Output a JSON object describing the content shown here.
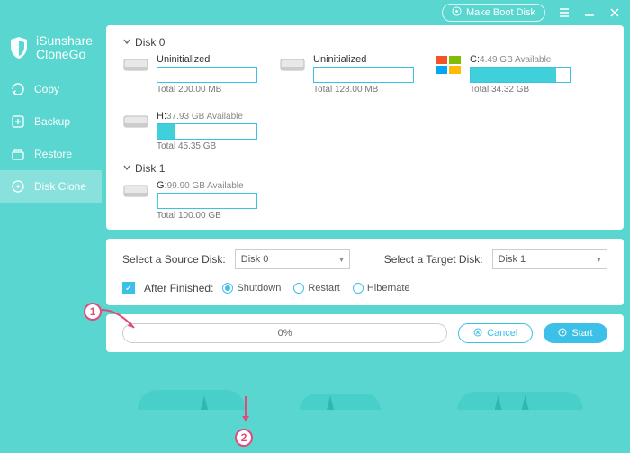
{
  "app": {
    "brand1": "iSunshare",
    "brand2": "CloneGo"
  },
  "titlebar": {
    "make_boot": "Make Boot Disk"
  },
  "sidebar": {
    "items": [
      {
        "label": "Copy"
      },
      {
        "label": "Backup"
      },
      {
        "label": "Restore"
      },
      {
        "label": "Disk Clone"
      }
    ]
  },
  "disks": {
    "d0": {
      "title": "Disk 0",
      "parts": [
        {
          "name": "Uninitialized",
          "avail": "",
          "total": "Total 200.00 MB",
          "fill": 0
        },
        {
          "name": "Uninitialized",
          "avail": "",
          "total": "Total 128.00 MB",
          "fill": 0
        },
        {
          "name": "C:",
          "avail": "4.49 GB Available",
          "total": "Total 34.32 GB",
          "fill": 86,
          "os": true
        },
        {
          "name": "H:",
          "avail": "37.93 GB Available",
          "total": "Total 45.35 GB",
          "fill": 17
        }
      ]
    },
    "d1": {
      "title": "Disk 1",
      "parts": [
        {
          "name": "G:",
          "avail": "99.90 GB Available",
          "total": "Total 100.00 GB",
          "fill": 1
        }
      ]
    }
  },
  "controls": {
    "source_label": "Select a Source Disk:",
    "source_value": "Disk 0",
    "target_label": "Select a Target Disk:",
    "target_value": "Disk 1",
    "after_label": "After Finished:",
    "after_checked": true,
    "radios": [
      {
        "label": "Shutdown",
        "checked": true
      },
      {
        "label": "Restart",
        "checked": false
      },
      {
        "label": "Hibernate",
        "checked": false
      }
    ]
  },
  "footer": {
    "progress": "0%",
    "cancel": "Cancel",
    "start": "Start"
  },
  "callouts": {
    "c1": "1",
    "c2": "2"
  }
}
